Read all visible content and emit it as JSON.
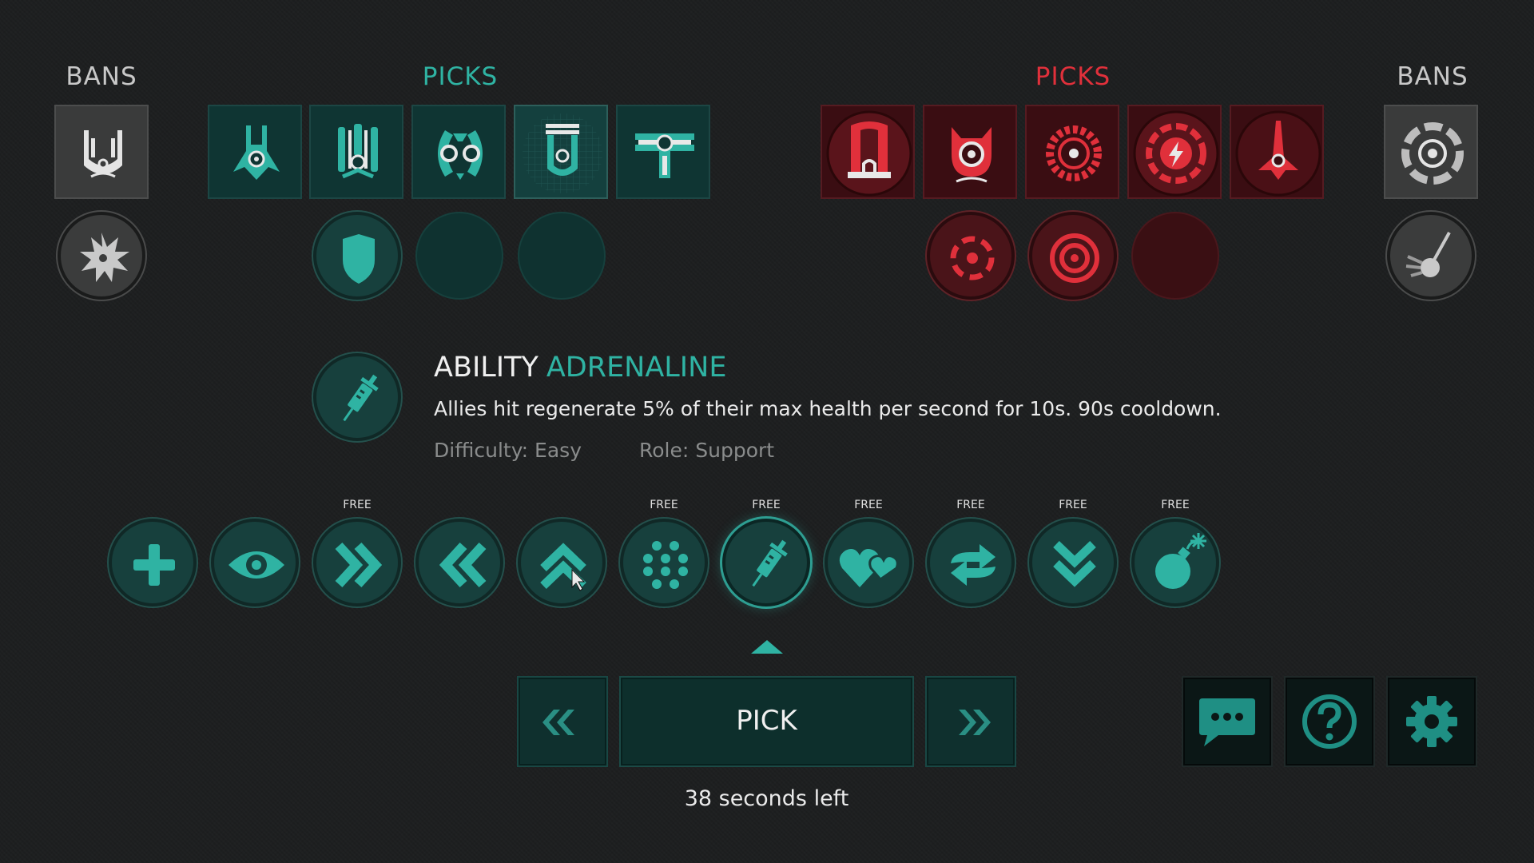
{
  "headers": {
    "left_bans": "BANS",
    "team_picks": "PICKS",
    "enemy_picks": "PICKS",
    "right_bans": "BANS"
  },
  "colors": {
    "team": "#2fb3a3",
    "enemy": "#e0303b",
    "neutral": "#c8c8c8"
  },
  "team": {
    "banned_ship_icon": "ship-icon",
    "banned_ability_icon": "starburst-icon",
    "picks": [
      {
        "icon": "ship-fighter-icon",
        "selected": false
      },
      {
        "icon": "ship-trident-icon",
        "selected": false
      },
      {
        "icon": "ship-twin-pod-icon",
        "selected": false
      },
      {
        "icon": "ship-engine-icon",
        "selected": true
      },
      {
        "icon": "ship-crossbar-icon",
        "selected": false
      }
    ],
    "abilities": [
      "shield-icon",
      "empty",
      "empty"
    ]
  },
  "enemy": {
    "picks": [
      "ship-arch-icon",
      "ship-horned-icon",
      "ship-sawblade-icon",
      "ship-lightning-icon",
      "ship-spike-icon"
    ],
    "abilities": [
      "crosshair-icon",
      "target-icon",
      "empty"
    ],
    "banned_ship_icon": "ship-wheel-icon",
    "banned_ability_icon": "comet-icon"
  },
  "ability": {
    "label": "ABILITY",
    "name": "ADRENALINE",
    "icon": "syringe-icon",
    "description": "Allies hit regenerate 5% of their max health per second for 10s. 90s cooldown.",
    "difficulty": "Difficulty: Easy",
    "role": "Role: Support"
  },
  "ability_options": [
    {
      "icon": "plus-icon",
      "badge": ""
    },
    {
      "icon": "eye-icon",
      "badge": ""
    },
    {
      "icon": "double-chevron-right-icon",
      "badge": "FREE"
    },
    {
      "icon": "double-chevron-left-icon",
      "badge": ""
    },
    {
      "icon": "double-chevron-up-icon",
      "badge": ""
    },
    {
      "icon": "dot-grid-icon",
      "badge": "FREE"
    },
    {
      "icon": "syringe-icon",
      "badge": "FREE",
      "selected": true
    },
    {
      "icon": "hearts-icon",
      "badge": "FREE"
    },
    {
      "icon": "swap-arrows-icon",
      "badge": "FREE"
    },
    {
      "icon": "double-chevron-down-icon",
      "badge": "FREE"
    },
    {
      "icon": "bomb-icon",
      "badge": "FREE"
    }
  ],
  "actions": {
    "pick_label": "PICK",
    "prev_icon": "double-angle-left-icon",
    "next_icon": "double-angle-right-icon",
    "chat_icon": "chat-icon",
    "help_icon": "help-icon",
    "settings_icon": "gear-icon"
  },
  "timer": "38 seconds left"
}
